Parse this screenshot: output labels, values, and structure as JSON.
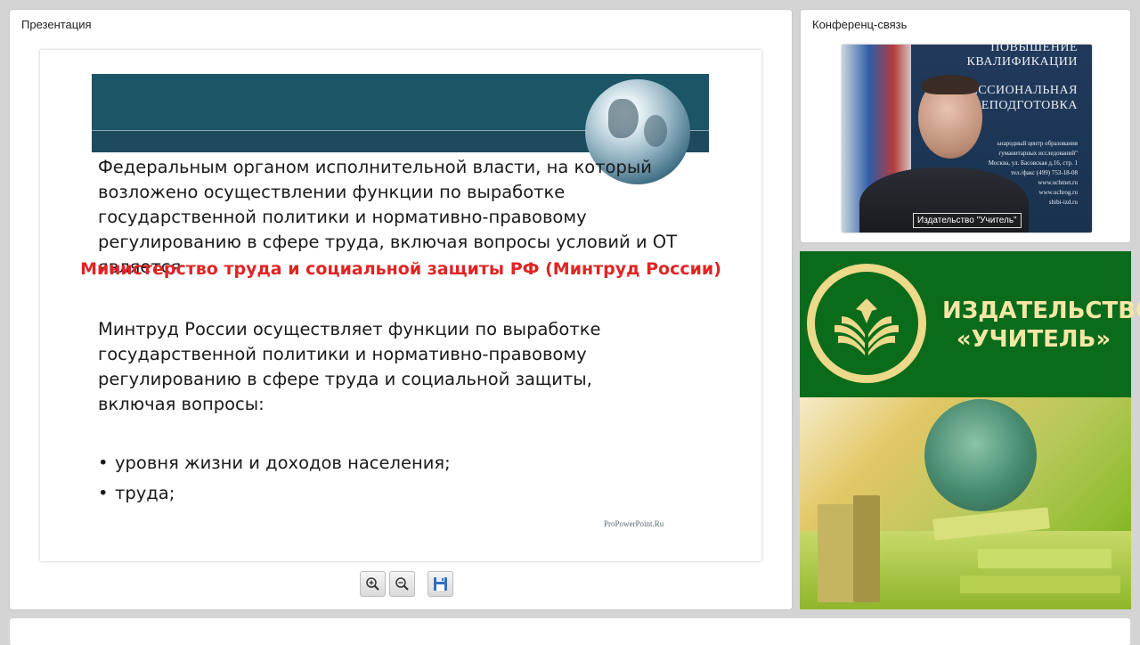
{
  "presentation_panel": {
    "title": "Презентация",
    "slide": {
      "paragraph1": "Федеральным органом исполнительной власти, на который возложено осуществлении функции по выработке государственной политики и нормативно-правовому регулированию в сфере труда, включая вопросы условий и ОТ является",
      "highlight": "Министерство труда и социальной защиты РФ (Минтруд России)",
      "paragraph2": "Минтруд России осуществляет функции по выработке государственной политики и нормативно-правовому регулированию в сфере труда и социальной защиты, включая вопросы:",
      "bullets": [
        "уровня жизни и доходов населения;",
        "труда;"
      ],
      "bullet_symbol": "•",
      "credit": "ProPowerPoint.Ru"
    },
    "toolbar": {
      "buttons": [
        {
          "name": "zoom-in",
          "icon": "zoom-in-icon"
        },
        {
          "name": "zoom-out",
          "icon": "zoom-out-icon"
        },
        {
          "name": "save",
          "icon": "save-icon"
        }
      ]
    }
  },
  "conference_panel": {
    "title": "Конференц-связь",
    "video": {
      "participant_label": "Издательство \"Учитель\"",
      "background_text": {
        "line1": "ПОВЫШЕНИЕ",
        "line2": "КВАЛИФИКАЦИИ",
        "line3": "ФЕССИОНАЛЬНАЯ",
        "line4": "РЕПОДГОТОВКА",
        "small1": "ьнародный центр образования",
        "small2": "гуманитарных исследований\"",
        "small3": "Москва, ул. Басовская д.16, стр. 1",
        "small4": "тел./факс (499) 753-18-08",
        "small5": "www.uchmet.ru",
        "small6": "www.uchrog.ru",
        "small7": "shibi-izd.ru"
      }
    }
  },
  "publisher_banner": {
    "line1": "ИЗДАТЕЛЬСТВО",
    "line2": "«УЧИТЕЛЬ»"
  },
  "colors": {
    "slide_banner": "#1b5566",
    "highlight_text": "#e02424",
    "publisher_green": "#0a6b1b",
    "publisher_gold": "#f4e7a6"
  }
}
